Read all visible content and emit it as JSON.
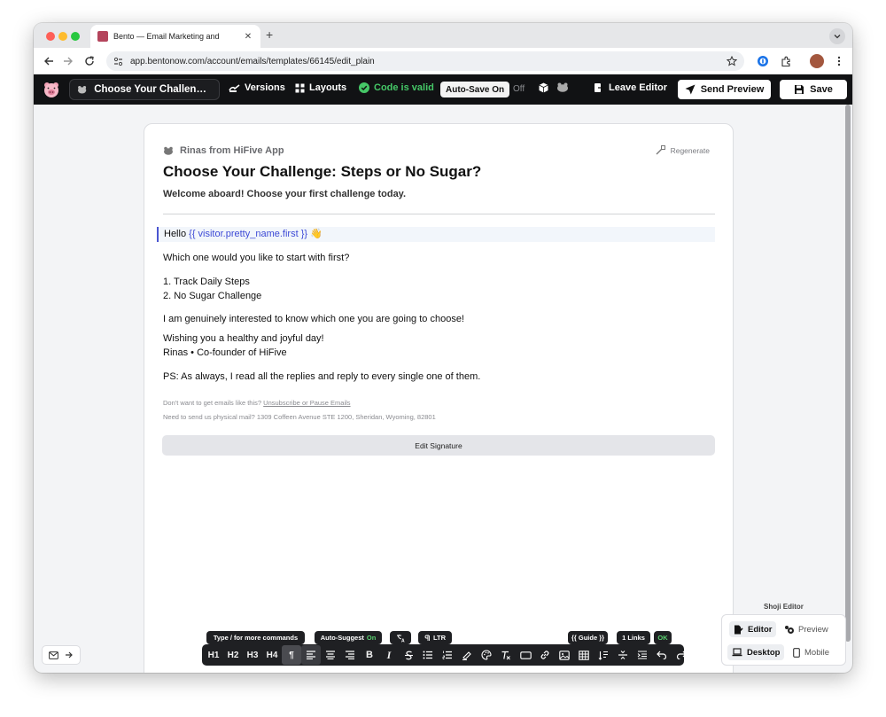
{
  "browser": {
    "tab_title": "Bento — Email Marketing and",
    "url": "app.bentonow.com/account/emails/templates/66145/edit_plain"
  },
  "header": {
    "doc_title": "Choose Your Challenge:...",
    "versions": "Versions",
    "layouts": "Layouts",
    "code_status": "Code is valid",
    "autosave": "Auto-Save On",
    "off": "Off",
    "leave_editor": "Leave Editor",
    "send_preview": "Send Preview",
    "save": "Save"
  },
  "email": {
    "sender": "Rinas from HiFive App",
    "regenerate": "Regenerate",
    "subject": "Choose Your Challenge: Steps or No Sugar?",
    "preheader": "Welcome aboard! Choose your first challenge today.",
    "hello": "Hello",
    "hello_var": "{{ visitor.pretty_name.first }}",
    "hello_emoji": "👋",
    "question": "Which one would you like to start with first?",
    "list": [
      "1. Track Daily Steps",
      "2. No Sugar Challenge"
    ],
    "interest": "I am genuinely interested to know which one you are going to choose!",
    "wishing": "Wishing you a healthy and joyful day!",
    "signature": "Rinas • Co-founder of HiFive",
    "ps": "PS: As always, I read all the replies and reply to every single one of them.",
    "footer_unsub_prefix": "Don't want to get emails like this?",
    "footer_unsub_link": "Unsubscribe or Pause Emails",
    "footer_address": "Need to send us physical mail? 1309 Coffeen Avenue STE 1200, Sheridan, Wyoming, 82801",
    "edit_signature": "Edit Signature"
  },
  "toolbar": {
    "hint": "Type / for more commands",
    "autosuggest": "Auto-Suggest",
    "autosuggest_state": "On",
    "ltr": "LTR",
    "guide": "{{ Guide }}",
    "links": "1 Links",
    "ok": "OK",
    "h1": "H1",
    "h2": "H2",
    "h3": "H3",
    "h4": "H4",
    "paragraph": "¶",
    "bold": "B",
    "italic": "I"
  },
  "shoji": {
    "label": "Shoji Editor",
    "editor": "Editor",
    "preview": "Preview",
    "desktop": "Desktop",
    "mobile": "Mobile"
  },
  "colors": {
    "header_bg": "#111214",
    "valid_green": "#45c767",
    "variable_blue": "#3d4ad6"
  }
}
